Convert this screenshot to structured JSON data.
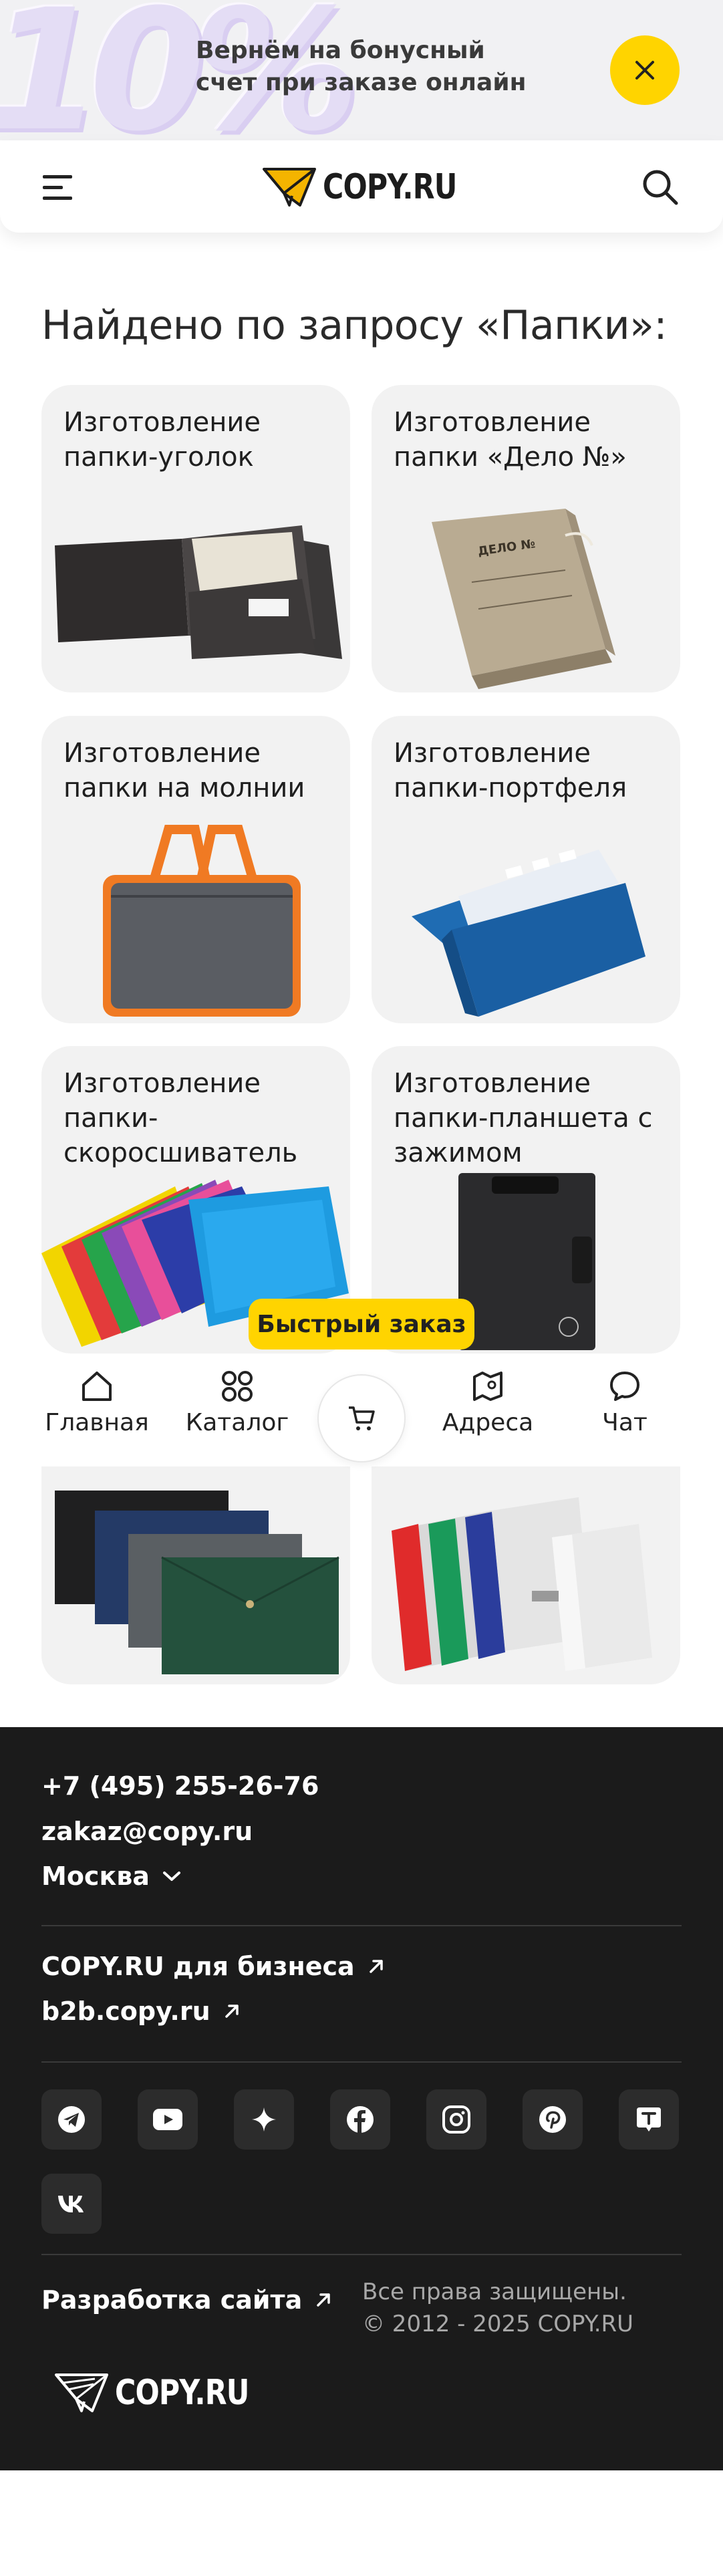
{
  "promo": {
    "graphic_text": "10%",
    "text": "Вернём на бонусный счет при заказе онлайн",
    "accent_color": "#ffd400"
  },
  "header": {
    "logo_text": "COPY.RU",
    "menu_icon": "hamburger-icon",
    "search_icon": "search-icon"
  },
  "results": {
    "title": "Найдено по запросу «Папки»:",
    "cards": [
      {
        "title": "Изготовление папки-уголок",
        "image": "black-corner-folder"
      },
      {
        "title": "Изготовление папки «Дело №»",
        "image": "cardboard-delo-folder"
      },
      {
        "title": "Изготовление папки на молнии",
        "image": "gray-zip-bag-folder"
      },
      {
        "title": "Изготовление папки-портфеля",
        "image": "blue-expanding-folder"
      },
      {
        "title": "Изготовление папки-скоросшиватель",
        "image": "colorful-binder-folders"
      },
      {
        "title": "Изготовление папки-планшета с зажимом",
        "image": "black-clipboard-folder"
      },
      {
        "title": "",
        "image": "envelope-button-folders"
      },
      {
        "title": "",
        "image": "archive-box-folders"
      }
    ]
  },
  "fast_order": {
    "label": "Быстрый заказ"
  },
  "bottom_nav": {
    "items": [
      {
        "label": "Главная",
        "icon": "home-icon"
      },
      {
        "label": "Каталог",
        "icon": "catalog-icon"
      },
      {
        "label": "",
        "icon": "cart-icon"
      },
      {
        "label": "Адреса",
        "icon": "map-pin-icon"
      },
      {
        "label": "Чат",
        "icon": "chat-icon"
      }
    ]
  },
  "footer": {
    "phone": "+7 (495) 255-26-76",
    "email": "zakaz@copy.ru",
    "city": "Москва",
    "business_link": "COPY.RU для бизнеса",
    "b2b_link": "b2b.copy.ru",
    "socials": [
      "telegram-icon",
      "youtube-icon",
      "sparkle-icon",
      "facebook-icon",
      "instagram-icon",
      "pinterest-icon",
      "t-icon",
      "vk-icon"
    ],
    "dev_link": "Разработка сайта",
    "copyright_line1": "Все права защищены.",
    "copyright_line2": "© 2012 - 2025 COPY.RU",
    "logo_text": "COPY.RU"
  }
}
